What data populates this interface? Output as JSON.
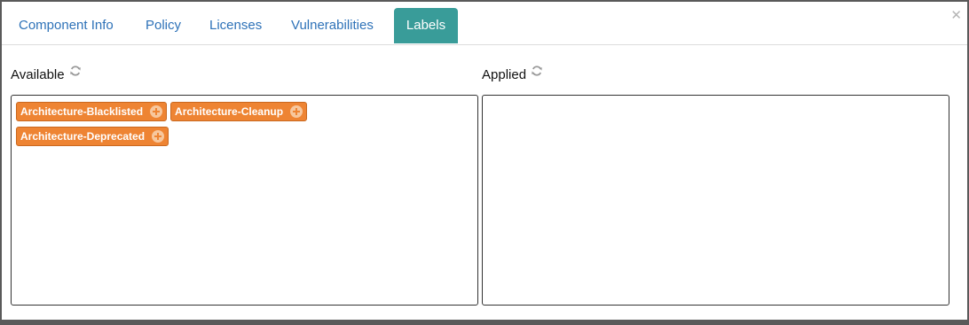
{
  "tabs": [
    {
      "label": "Component Info"
    },
    {
      "label": "Policy"
    },
    {
      "label": "Licenses"
    },
    {
      "label": "Vulnerabilities"
    },
    {
      "label": "Labels",
      "active": true
    }
  ],
  "close_icon": "close-icon",
  "available": {
    "title": "Available",
    "refresh_icon": "refresh-icon",
    "labels": [
      {
        "name": "Architecture-Blacklisted"
      },
      {
        "name": "Architecture-Cleanup"
      },
      {
        "name": "Architecture-Deprecated"
      }
    ]
  },
  "applied": {
    "title": "Applied",
    "refresh_icon": "refresh-icon",
    "labels": []
  },
  "colors": {
    "active_tab": "#399c99",
    "tab_text": "#2e72b8",
    "label_chip": "#ee8433"
  }
}
